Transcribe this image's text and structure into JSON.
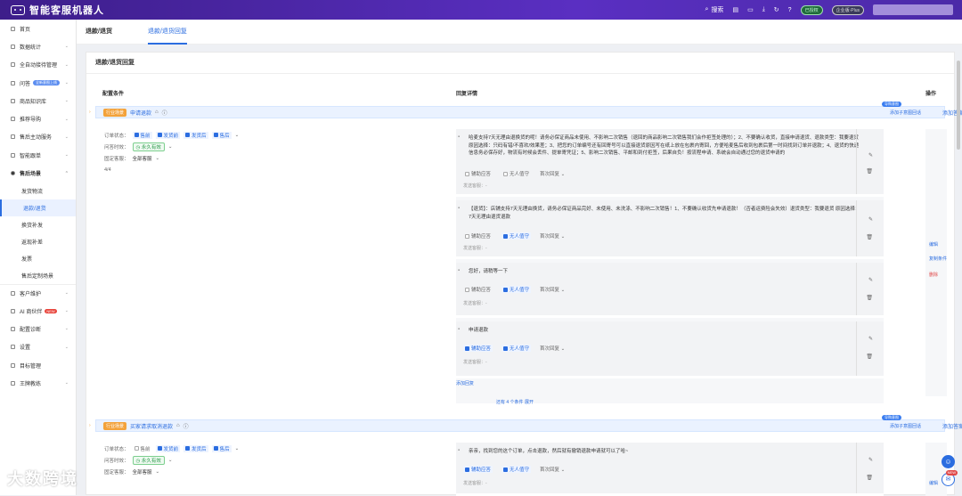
{
  "app": {
    "title": "智能客服机器人"
  },
  "topbar": {
    "search": "搜索",
    "status_pill": "已授权",
    "plan_pill": "企业版·Plus"
  },
  "sidebar": {
    "items": [
      {
        "label": "首页",
        "chev": false
      },
      {
        "label": "数据统计",
        "chev": true
      },
      {
        "label": "全自动接待管理",
        "chev": true
      },
      {
        "label": "问答",
        "tag": "全新意图上线",
        "chev": true
      },
      {
        "label": "商品知识库",
        "chev": true
      },
      {
        "label": "推荐导购",
        "chev": true
      },
      {
        "label": "售后主动服务",
        "chev": true
      },
      {
        "label": "智能跟单",
        "chev": true
      },
      {
        "label": "售后场景",
        "chev": true,
        "bold": true
      },
      {
        "label": "发货物流",
        "sub": true
      },
      {
        "label": "退款/退货",
        "sub": true,
        "active": true
      },
      {
        "label": "换货补发",
        "sub": true
      },
      {
        "label": "返现补差",
        "sub": true
      },
      {
        "label": "发票",
        "sub": true
      },
      {
        "label": "售后定制场景",
        "sub": true
      },
      {
        "label": "客户维护",
        "chev": true
      },
      {
        "label": "AI 商伙伴",
        "new": "NEW",
        "chev": true
      },
      {
        "label": "配置诊断",
        "chev": true
      },
      {
        "label": "设置",
        "chev": true
      },
      {
        "label": "目标管理",
        "chev": false
      },
      {
        "label": "王牌教练",
        "chev": true
      }
    ]
  },
  "tabs": [
    "退款/退货",
    "退款/退货回复"
  ],
  "panel": {
    "title": "退款/退货回复",
    "col_condition": "配置条件",
    "col_reply": "回复详情",
    "col_ops": "操作"
  },
  "rules": [
    {
      "badge": "行业场景",
      "name": "申请退款",
      "add": "添加子意图回话",
      "hint": "导购意图",
      "add_ops": "添加答案",
      "order_status_label": "订单状态：",
      "statuses": [
        {
          "t": "售前",
          "on": true
        },
        {
          "t": "发货前",
          "on": true
        },
        {
          "t": "发货后",
          "on": true
        },
        {
          "t": "售后",
          "on": true
        }
      ],
      "time_label": "问答时效：",
      "time_val": "永久有效",
      "shop_label": "固定客服：",
      "shop_val": "全部客服",
      "count": "4/4",
      "cards": [
        {
          "text": "哈麦支持7天无理由退换货的呢！请务必保证商品未使用、不影响二次销售（退回的商品影响二次销售我们会作拒签处理的）；2、不要确认收货，直接申请退货、退款类型：我要退货 原因选择：只码有错/不喜欢/效果差；3、把您的订单编号还有回寄号可以直接退货原因写在纸上放在包裹内寄回，方便哈麦售后收到包裹后第一时间找到订单并退款；4、退货的快递信息务必保存好，物流有时候会丢件、提单寄凭证；5、影响二次销售、平邮和到付拒签，后果自负！按流程申请、系统会自动通过您的退货申请的",
          "c1": "辅助应答",
          "c1on": false,
          "c2": "无人值守",
          "c2on": false,
          "c3": "首次回复",
          "sender": "发送客服：-"
        },
        {
          "text": "【退货】：店铺支持7天无理由换货，请务必保证商品完好、未使用、未洗涤、不影响二次销售！1、不要确认收货先申请退款！（否者运费险会失效）退货类型：我要退货 原因选择：7天无理由退货退款",
          "c1": "辅助应答",
          "c1on": false,
          "c2": "无人值守",
          "c2on": true,
          "c3": "首次回复",
          "sender": "发送客服：-"
        },
        {
          "text": "您好，请稍等一下",
          "c1": "辅助应答",
          "c1on": false,
          "c2": "无人值守",
          "c2on": true,
          "c3": "首次回复",
          "sender": "发送客服：-"
        },
        {
          "text": "申请退款",
          "c1": "辅助应答",
          "c1on": true,
          "c2": "无人值守",
          "c2on": true,
          "c3": "首次回复",
          "sender": "发送客服：-"
        }
      ],
      "add_reply": "添加回复",
      "more": "还有 4 个条件  展开",
      "ops": [
        "编辑",
        "复制条件",
        "删除"
      ]
    },
    {
      "badge": "行业场景",
      "name": "买家请求取消退款",
      "add": "添加子意图回话",
      "hint": "导购意图",
      "add_ops": "添加答案",
      "order_status_label": "订单状态：",
      "statuses": [
        {
          "t": "售前",
          "on": false
        },
        {
          "t": "发货前",
          "on": true
        },
        {
          "t": "发货后",
          "on": true
        },
        {
          "t": "售后",
          "on": true
        }
      ],
      "time_label": "问答时效：",
      "time_val": "永久有效",
      "shop_label": "固定客服：",
      "shop_val": "全部客服",
      "cards": [
        {
          "text": "亲亲，找到您的这个订单，点击退款，然后就有撤销退款申请就可以了哈~",
          "c1": "辅助应答",
          "c1on": true,
          "c2": "无人值守",
          "c2on": true,
          "c3": "首次回复",
          "sender": "发送客服：-"
        }
      ],
      "ops": [
        "编辑"
      ]
    }
  ],
  "watermark": "大数跨境",
  "chat_badge": "NEW"
}
